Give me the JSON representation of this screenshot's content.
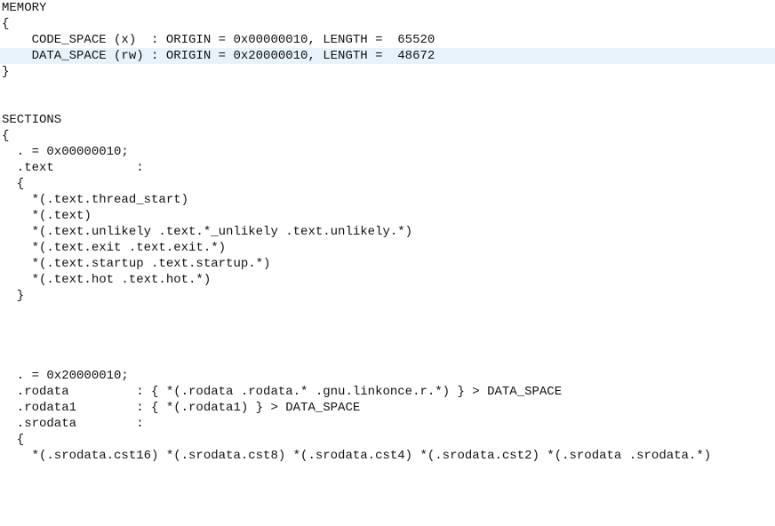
{
  "lines": [
    {
      "text": "MEMORY",
      "hl": false
    },
    {
      "text": "{",
      "hl": false
    },
    {
      "text": "    CODE_SPACE (x)  : ORIGIN = 0x00000010, LENGTH =  65520",
      "hl": false
    },
    {
      "text": "    DATA_SPACE (rw) : ORIGIN = 0x20000010, LENGTH =  48672",
      "hl": true
    },
    {
      "text": "}",
      "hl": false
    },
    {
      "text": "",
      "hl": false
    },
    {
      "text": "",
      "hl": false
    },
    {
      "text": "SECTIONS",
      "hl": false
    },
    {
      "text": "{",
      "hl": false
    },
    {
      "text": "  . = 0x00000010;",
      "hl": false
    },
    {
      "text": "  .text           :",
      "hl": false
    },
    {
      "text": "  {",
      "hl": false
    },
    {
      "text": "    *(.text.thread_start)",
      "hl": false
    },
    {
      "text": "    *(.text)",
      "hl": false
    },
    {
      "text": "    *(.text.unlikely .text.*_unlikely .text.unlikely.*)",
      "hl": false
    },
    {
      "text": "    *(.text.exit .text.exit.*)",
      "hl": false
    },
    {
      "text": "    *(.text.startup .text.startup.*)",
      "hl": false
    },
    {
      "text": "    *(.text.hot .text.hot.*)",
      "hl": false
    },
    {
      "text": "  }",
      "hl": false
    },
    {
      "text": "",
      "hl": false
    },
    {
      "text": "",
      "hl": false
    },
    {
      "text": "",
      "hl": false
    },
    {
      "text": "",
      "hl": false
    },
    {
      "text": "  . = 0x20000010;",
      "hl": false
    },
    {
      "text": "  .rodata         : { *(.rodata .rodata.* .gnu.linkonce.r.*) } > DATA_SPACE",
      "hl": false
    },
    {
      "text": "  .rodata1        : { *(.rodata1) } > DATA_SPACE",
      "hl": false
    },
    {
      "text": "  .srodata        :",
      "hl": false
    },
    {
      "text": "  {",
      "hl": false
    },
    {
      "text": "    *(.srodata.cst16) *(.srodata.cst8) *(.srodata.cst4) *(.srodata.cst2) *(.srodata .srodata.*)",
      "hl": false
    }
  ]
}
